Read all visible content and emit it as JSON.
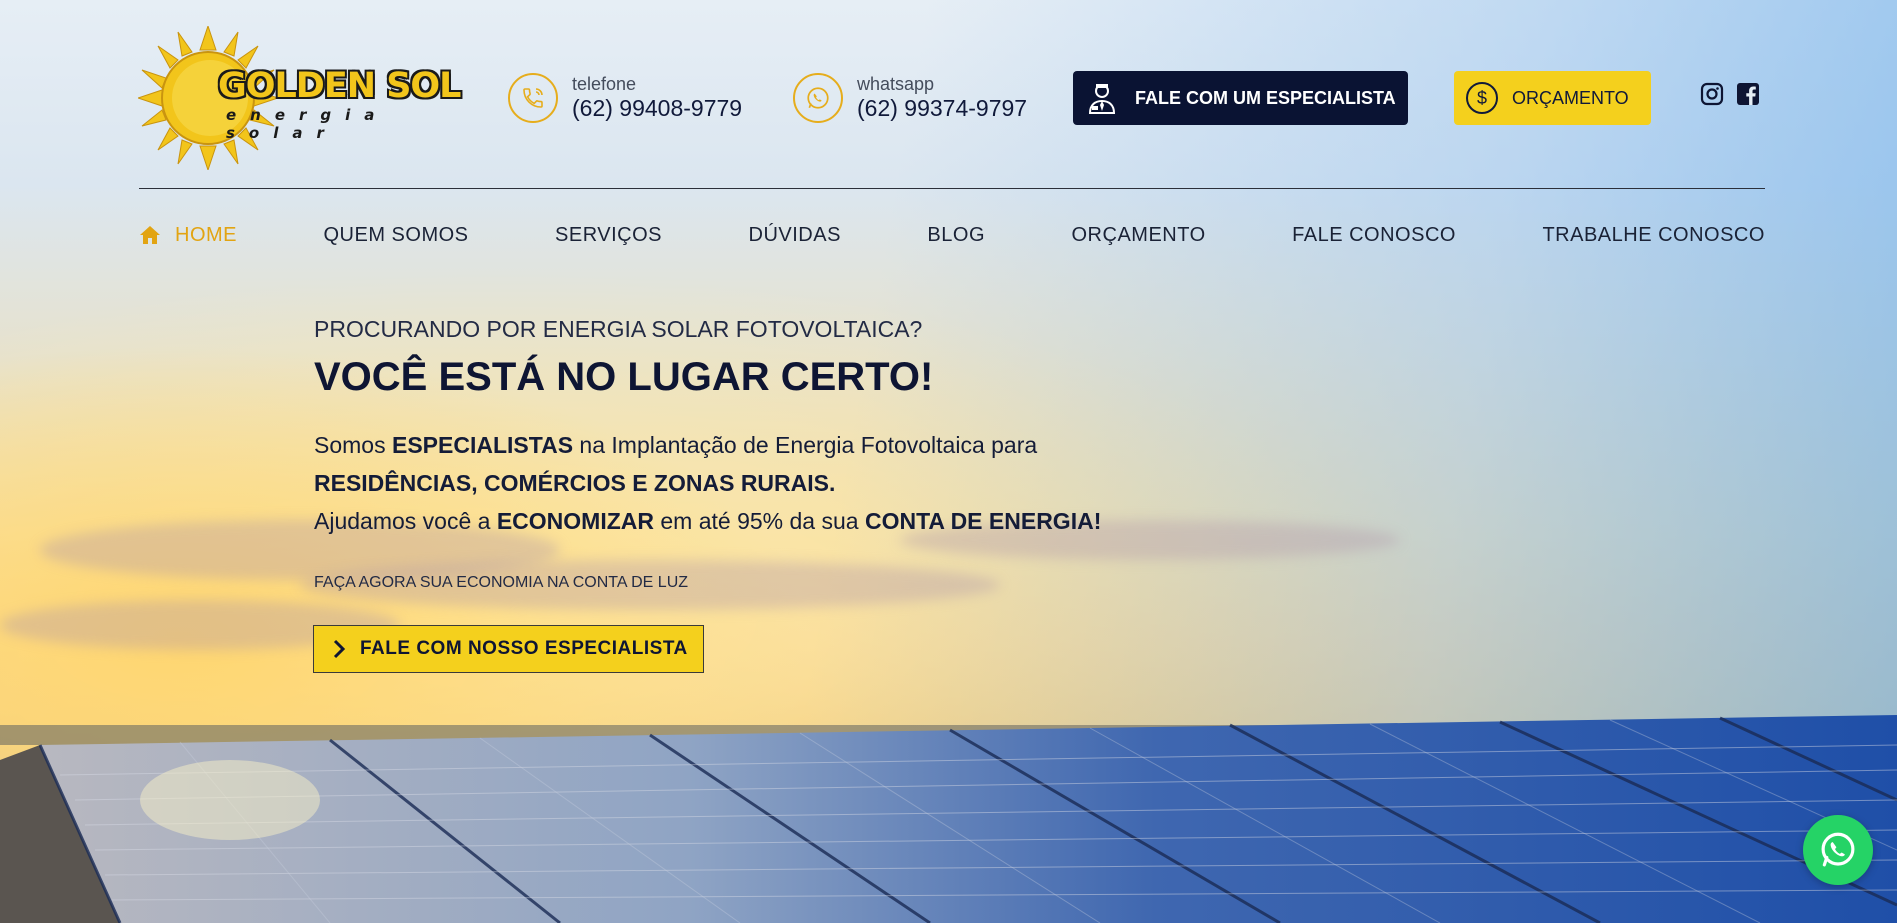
{
  "brand": {
    "name": "GOLDEN SOL",
    "tagline": "energia solar"
  },
  "header": {
    "phone": {
      "label": "telefone",
      "number": "(62) 99408-9779",
      "icon": "phone-icon"
    },
    "whatsapp": {
      "label": "whatsapp",
      "number": "(62) 99374-9797",
      "icon": "whatsapp-icon"
    },
    "specialist_button": {
      "label": "FALE COM UM ESPECIALISTA",
      "icon": "specialist-icon"
    },
    "quote_button": {
      "label": "ORÇAMENTO",
      "icon": "dollar-coin-icon"
    },
    "social": [
      "instagram-icon",
      "facebook-icon"
    ]
  },
  "nav": {
    "items": [
      {
        "label": "HOME",
        "active": true
      },
      {
        "label": "QUEM SOMOS"
      },
      {
        "label": "SERVIÇOS"
      },
      {
        "label": "DÚVIDAS"
      },
      {
        "label": "BLOG"
      },
      {
        "label": "ORÇAMENTO"
      },
      {
        "label": "FALE CONOSCO"
      },
      {
        "label": "TRABALHE CONOSCO"
      }
    ]
  },
  "hero": {
    "eyebrow": "PROCURANDO POR ENERGIA SOLAR FOTOVOLTAICA?",
    "headline": "VOCÊ ESTÁ NO LUGAR CERTO!",
    "line1_a": "Somos ",
    "line1_b": "ESPECIALISTAS",
    "line1_c": " na Implantação de Energia Fotovoltaica para",
    "line2": "RESIDÊNCIAS, COMÉRCIOS E ZONAS RURAIS.",
    "line3_a": "Ajudamos você a ",
    "line3_b": "ECONOMIZAR",
    "line3_c": " em até 95% da sua ",
    "line3_d": "CONTA DE ENERGIA!",
    "cta_label": "FAÇA AGORA SUA ECONOMIA NA CONTA DE LUZ",
    "cta_button": "FALE COM NOSSO ESPECIALISTA"
  },
  "colors": {
    "accent_yellow": "#f4d01d",
    "navy": "#0a1333",
    "orange": "#e2a412",
    "whatsapp_green": "#25d366"
  },
  "floating": {
    "icon": "whatsapp-float-icon"
  }
}
